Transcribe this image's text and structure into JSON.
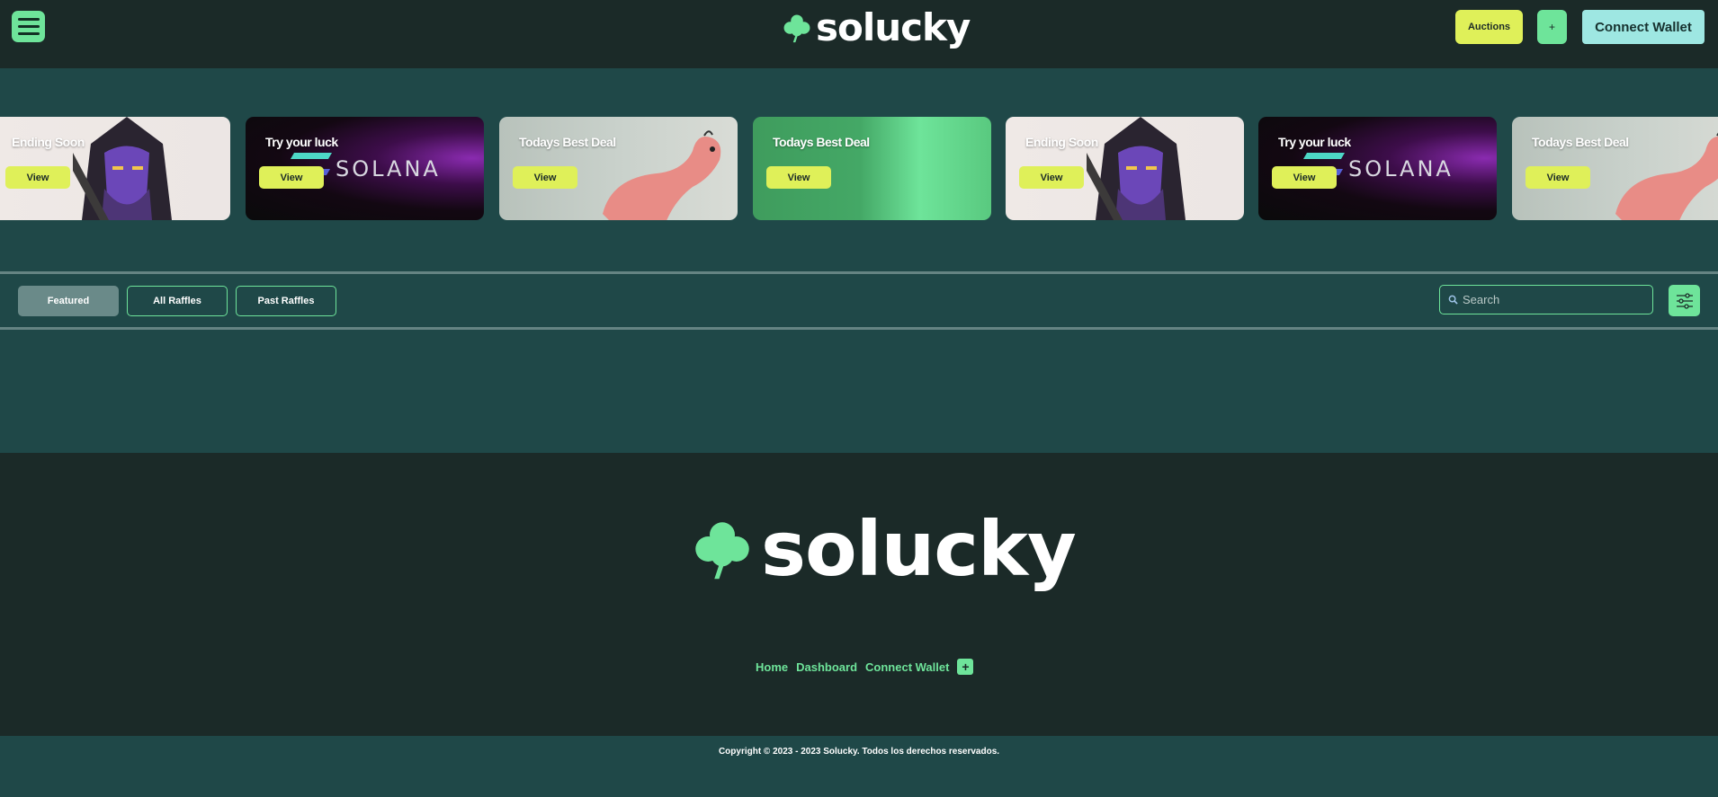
{
  "header": {
    "logo_text": "solucky",
    "auctions_label": "Auctions",
    "plus_label": "+",
    "connect_label": "Connect Wallet"
  },
  "carousel": {
    "cards": [
      {
        "title": "Ending Soon",
        "button": "View",
        "theme": "ending"
      },
      {
        "title": "Try your luck",
        "button": "View",
        "theme": "solana",
        "brand": "SOLANA"
      },
      {
        "title": "Todays Best Deal",
        "button": "View",
        "theme": "deal"
      },
      {
        "title": "Todays Best Deal",
        "button": "View",
        "theme": "green"
      },
      {
        "title": "Ending Soon",
        "button": "View",
        "theme": "ending"
      },
      {
        "title": "Try your luck",
        "button": "View",
        "theme": "solana",
        "brand": "SOLANA"
      },
      {
        "title": "Todays Best Deal",
        "button": "View",
        "theme": "deal"
      }
    ]
  },
  "tabs": {
    "featured": "Featured",
    "all": "All Raffles",
    "past": "Past Raffles"
  },
  "search": {
    "placeholder": "Search"
  },
  "footer": {
    "logo_text": "solucky",
    "links": [
      "Home",
      "Dashboard",
      "Connect Wallet"
    ],
    "plus_label": "+",
    "copyright": "Copyright © 2023 - 2023 Solucky. Todos los derechos reservados."
  },
  "colors": {
    "accent_green": "#6ee49a",
    "accent_yellow": "#dff059",
    "accent_cyan": "#9ee7e2",
    "dark_bg": "#1b2a28",
    "teal_bg": "#1f4848"
  }
}
